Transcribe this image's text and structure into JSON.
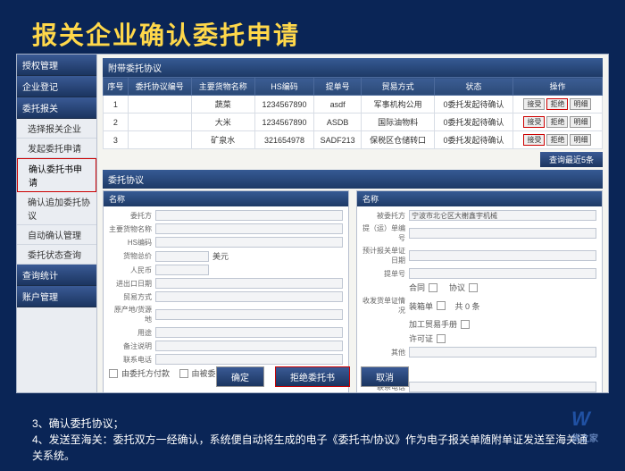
{
  "title": "报关企业确认委托申请",
  "sidebar": {
    "sections": [
      {
        "label": "授权管理",
        "items": []
      },
      {
        "label": "企业登记",
        "items": []
      },
      {
        "label": "委托报关",
        "items": [
          {
            "label": "选择报关企业"
          },
          {
            "label": "发起委托申请"
          },
          {
            "label": "确认委托书申请",
            "hl": true
          },
          {
            "label": "确认追加委托协议"
          },
          {
            "label": "自动确认管理"
          },
          {
            "label": "委托状态查询"
          }
        ]
      },
      {
        "label": "查询统计",
        "items": []
      },
      {
        "label": "账户管理",
        "items": []
      }
    ]
  },
  "topSection": "附带委托协议",
  "table": {
    "cols": [
      "序号",
      "委托协议编号",
      "主要货物名称",
      "HS编码",
      "提单号",
      "贸易方式",
      "状态",
      "操作"
    ],
    "rows": [
      {
        "c": [
          "1",
          "",
          "蔬菜",
          "1234567890",
          "asdf",
          "军事机构公用",
          "0委托发起待确认"
        ],
        "ops": [
          "接受",
          "拒绝",
          "明细"
        ],
        "hl": 1
      },
      {
        "c": [
          "2",
          "",
          "大米",
          "1234567890",
          "ASDB",
          "国际油物料",
          "0委托发起待确认"
        ],
        "ops": [
          "接受",
          "拒绝",
          "明细"
        ],
        "hl": 0
      },
      {
        "c": [
          "3",
          "",
          "矿泉水",
          "321654978",
          "SADF213",
          "保税区仓储转口",
          "0委托发起待确认"
        ],
        "ops": [
          "接受",
          "拒绝",
          "明细"
        ],
        "hl": 0
      }
    ]
  },
  "toolBtn": "查询最近5条",
  "panelsHd": "委托协议",
  "leftPanel": {
    "hd": "名称",
    "fields": [
      "委托方",
      "主要货物名称",
      "HS编码",
      "货物总价",
      "",
      "进出口日期",
      "贸易方式",
      "原产地/货源地",
      "用途"
    ],
    "cur": "美元",
    "rmb": "人民币",
    "remark": "备注说明",
    "phone": "联系电话",
    "pay1": "由委托方付款",
    "pay2": "由被委托方付款"
  },
  "rightPanel": {
    "hd": "名称",
    "shipper": "被委托方",
    "shipperVal": "宁波市北仑区大榭鑫宇机械",
    "bill": "提（运）单编号",
    "date": "预计报关单证日期",
    "docno": "提单号",
    "hetong": "合同",
    "xukezheng": "协议",
    "invoice": "装箱单",
    "info": "加工贸易手册",
    "bill2": "收发货单证情况",
    "other": "许可证",
    "qita": "其他",
    "checkN": "共 0 条",
    "phone": "联系电话"
  },
  "bottomBtns": {
    "ok": "确定",
    "reject": "拒绝委托书",
    "cancel": "取消"
  },
  "notes": {
    "l1": "3、确认委托协议；",
    "l2": "4、发送至海关：委托双方一经确认，系统便自动将生成的电子《委托书/协议》作为电子报关单随附单证发送至海关通关系统。"
  },
  "watermark": {
    "main": "W",
    "sub": "货之家"
  }
}
